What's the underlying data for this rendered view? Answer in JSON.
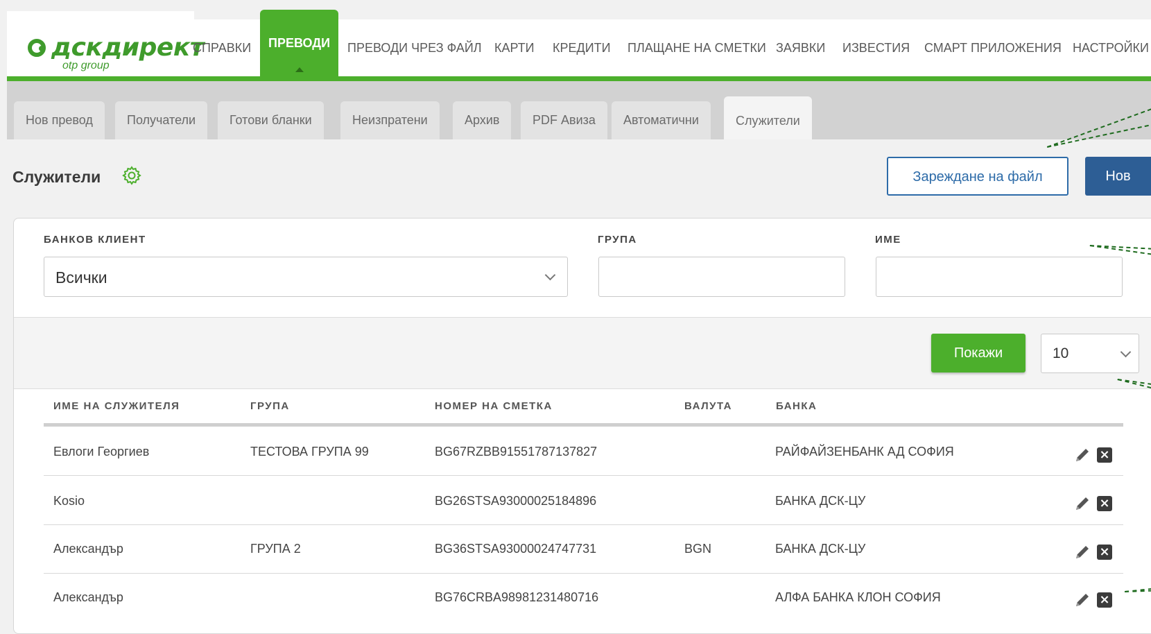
{
  "logo": {
    "brand": "дскдирект",
    "sub": "otp group"
  },
  "nav": {
    "items": [
      {
        "label": "СПРАВКИ"
      },
      {
        "label": "ПРЕВОДИ"
      },
      {
        "label": "ПРЕВОДИ ЧРЕЗ ФАЙЛ"
      },
      {
        "label": "КАРТИ"
      },
      {
        "label": "КРЕДИТИ"
      },
      {
        "label": "ПЛАЩАНЕ НА СМЕТКИ"
      },
      {
        "label": "ЗАЯВКИ"
      },
      {
        "label": "ИЗВЕСТИЯ"
      },
      {
        "label": "СМАРТ ПРИЛОЖЕНИЯ"
      },
      {
        "label": "НАСТРОЙКИ"
      }
    ],
    "active": "ПРЕВОДИ"
  },
  "subtabs": {
    "items": [
      {
        "label": "Нов превод"
      },
      {
        "label": "Получатели"
      },
      {
        "label": "Готови бланки"
      },
      {
        "label": "Неизпратени"
      },
      {
        "label": "Архив"
      },
      {
        "label": "PDF Авиза"
      },
      {
        "label": "Автоматични"
      },
      {
        "label": "Служители"
      }
    ],
    "active": "Служители"
  },
  "page": {
    "title": "Служители",
    "upload_button": "Зареждане на файл",
    "new_button": "Нов"
  },
  "filters": {
    "client_label": "БАНКОВ КЛИЕНТ",
    "client_value": "Всички",
    "group_label": "ГРУПА",
    "group_value": "",
    "name_label": "ИМЕ",
    "name_value": "",
    "show_button": "Покажи",
    "page_size": "10"
  },
  "table": {
    "headers": {
      "name": "ИМЕ НА СЛУЖИТЕЛЯ",
      "group": "ГРУПА",
      "account": "НОМЕР НА СМЕТКА",
      "currency": "ВАЛУТА",
      "bank": "БАНКА"
    },
    "rows": [
      {
        "name": "Евлоги Георгиев",
        "group": "ТЕСТОВА ГРУПА 99",
        "account": "BG67RZBB91551787137827",
        "currency": "",
        "bank": "РАЙФАЙЗЕНБАНК АД СОФИЯ"
      },
      {
        "name": "Kosio",
        "group": "",
        "account": "BG26STSA93000025184896",
        "currency": "",
        "bank": "БАНКА ДСК-ЦУ"
      },
      {
        "name": "Александър",
        "group": "ГРУПА 2",
        "account": "BG36STSA93000024747731",
        "currency": "BGN",
        "bank": "БАНКА ДСК-ЦУ"
      },
      {
        "name": "Александър",
        "group": "",
        "account": "BG76CRBA98981231480716",
        "currency": "",
        "bank": "АЛФА БАНКА КЛОН СОФИЯ"
      }
    ]
  },
  "colors": {
    "brand_green": "#4caf2c",
    "primary_blue": "#2d5e95"
  }
}
